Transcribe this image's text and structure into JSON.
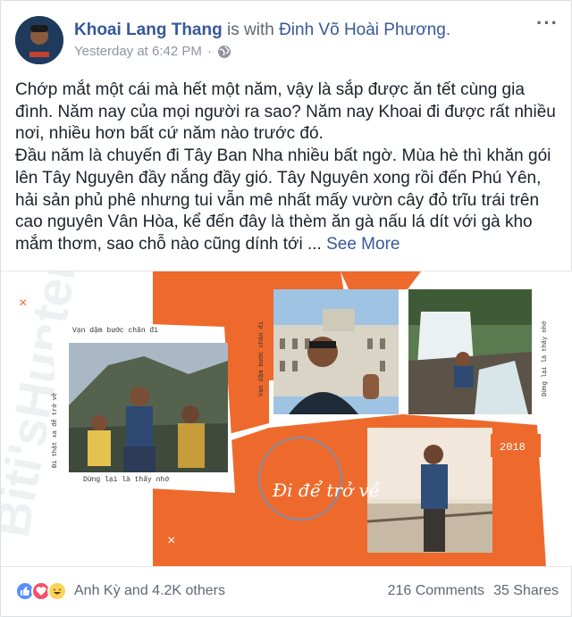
{
  "post": {
    "author": "Khoai Lang Thang",
    "with_text": "is with",
    "tagged": "Đinh Võ Hoài Phương",
    "dot": ".",
    "timestamp": "Yesterday at 6:42 PM",
    "separator": "·",
    "privacy_icon": "globe-icon",
    "more_icon": "···",
    "paragraph_1": "Chớp mắt một cái mà hết một năm, vậy là sắp được ăn tết cùng gia đình. Năm nay của mọi người ra sao? Năm nay Khoai đi được rất nhiều nơi, nhiều hơn bất cứ năm nào trước đó.",
    "paragraph_2": "Đầu năm là chuyến đi Tây Ban Nha nhiều bất ngờ. Mùa hè thì khăn gói lên Tây Nguyên đầy nắng đầy gió. Tây Nguyên xong rồi đến Phú Yên, hải sản phủ phê nhưng tui vẫn mê nhất mấy vườn cây đỏ trĩu trái trên cao nguyên Vân Hòa, kể đến đây là thèm ăn gà nấu lá dít với gà kho mắm thơm, sao chỗ nào cũng dính tới ...",
    "see_more": "See More"
  },
  "image": {
    "caption_top": "Vạn dặm bước chân đi",
    "caption_left": "Đi thật xa để trở về",
    "caption_bottom": "Dừng lại là thấy nhớ",
    "caption_vertical_mid": "Vạn dặm bước chân đi",
    "caption_right": "Dừng lại là thấy nhớ",
    "year": "2018",
    "brand": "Biti'sHunter",
    "slogan": "Đi để trở về",
    "side_brand": "Biti'sHunter",
    "colors": {
      "orange": "#ee6a2c",
      "blue_stamp": "#5b9bd5"
    }
  },
  "footer": {
    "reactions": [
      "like",
      "love",
      "haha"
    ],
    "reacted_by": "Anh Kỳ and 4.2K others",
    "comments": "216 Comments",
    "shares": "35 Shares"
  }
}
